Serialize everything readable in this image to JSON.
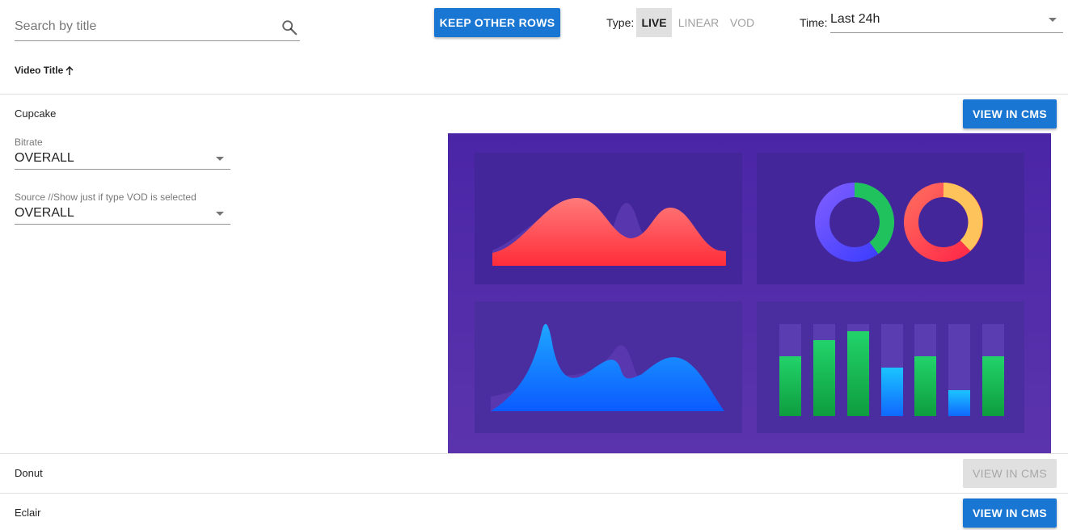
{
  "toolbar": {
    "search_placeholder": "Search by title",
    "keep_button": "KEEP OTHER ROWS",
    "type_label": "Type:",
    "type_options": [
      "LIVE",
      "LINEAR",
      "VOD"
    ],
    "type_selected": "LIVE",
    "time_label": "Time:",
    "time_value": "Last 24h"
  },
  "table": {
    "column_header": "Video Title",
    "sort": "ascending",
    "rows": [
      {
        "title": "Cupcake",
        "expanded": true,
        "action": "VIEW IN CMS",
        "action_enabled": true,
        "filters": [
          {
            "label": "Bitrate",
            "value": "OVERALL"
          },
          {
            "label": "Source //Show just if type VOD is selected",
            "value": "OVERALL"
          }
        ]
      },
      {
        "title": "Donut",
        "expanded": false,
        "action": "VIEW IN CMS",
        "action_enabled": false
      },
      {
        "title": "Eclair",
        "expanded": false,
        "action": "VIEW IN CMS",
        "action_enabled": true
      }
    ]
  },
  "colors": {
    "primary": "#1976d2",
    "dashboard_bg": "#4f2aa8",
    "panel_bg": "#43279a"
  },
  "icons": {
    "search": "search-icon",
    "sort": "arrow-up-icon",
    "dropdown": "caret-down-icon"
  }
}
